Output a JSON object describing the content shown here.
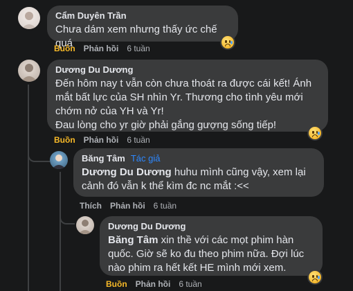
{
  "comments": [
    {
      "author": "Cẩm Duyên Trần",
      "text": "Chưa dám xem nhưng thấy ức chế quá",
      "reaction_label": "Buồn",
      "reply_label": "Phản hồi",
      "time": "6 tuần",
      "reaction_icon": "sad-face-icon"
    },
    {
      "author": "Dương Du Dương",
      "text": "Đến hôm nay t vẫn còn chưa thoát ra được cái kết! Ánh mắt bất lực của SH nhìn Yr. Thương cho tình yêu mới chớm nở của YH và Yr!\nĐau lòng cho yr giờ phải gắng gượng sống tiếp!",
      "reaction_label": "Buồn",
      "reply_label": "Phản hồi",
      "time": "6 tuần",
      "reaction_icon": "sad-face-icon"
    }
  ],
  "reply1": {
    "author": "Băng Tâm",
    "badge": "Tác giả",
    "mention": "Dương Du Dương",
    "text": " huhu mình cũng vậy, xem lại cảnh đó vẫn k thể kìm đc nc mắt :<<",
    "reaction_label": "Thích",
    "reply_label": "Phản hồi",
    "time": "6 tuần"
  },
  "reply2": {
    "author": "Dương Du Dương",
    "mention": "Băng Tâm",
    "text": " xin thề với các mọt phim hàn quốc. Giờ sẽ ko đu theo phim nữa. Đợi lúc nào phim ra hết kết HE mình mới xem.",
    "reaction_label": "Buồn",
    "reply_label": "Phản hồi",
    "time": "6 tuần",
    "reaction_icon": "sad-face-icon"
  },
  "colors": {
    "background": "#18191a",
    "bubble": "#3a3b3c",
    "author_badge": "#2d88ff",
    "sad_reaction": "#f7b928"
  }
}
